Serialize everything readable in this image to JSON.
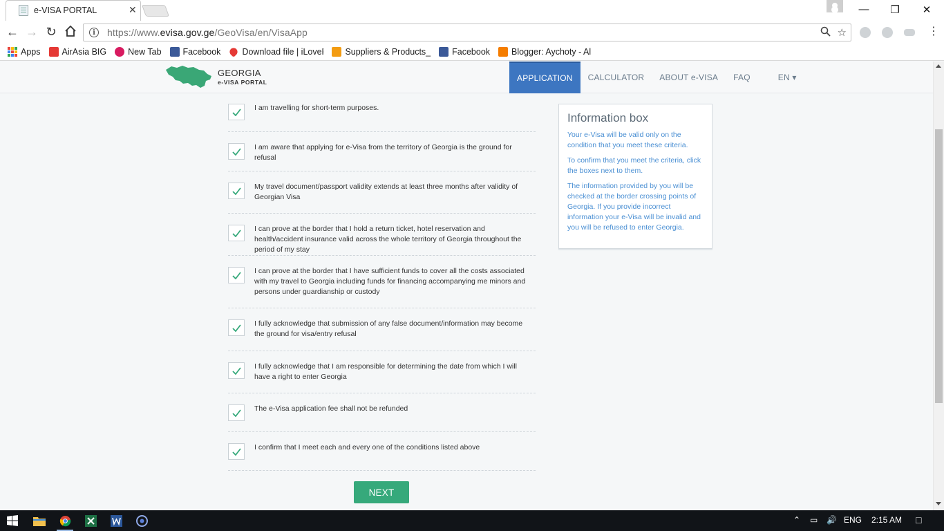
{
  "browser": {
    "tab_title": "e-VISA PORTAL",
    "tab_close": "✕",
    "url_prefix": "https://www.",
    "url_host": "evisa.gov.ge",
    "url_path": "/GeoVisa/en/VisaApp",
    "bookmarks": [
      {
        "label": "Apps",
        "icon": "apps-grid-icon",
        "color": "#e8453c"
      },
      {
        "label": "AirAsia BIG",
        "icon": "airasia-icon",
        "color": "#e53935"
      },
      {
        "label": "New Tab",
        "icon": "newtab-icon",
        "color": "#d81b60"
      },
      {
        "label": "Facebook",
        "icon": "facebook-icon",
        "color": "#3b5998"
      },
      {
        "label": "Download file | iLoveP",
        "icon": "heart-icon",
        "color": "#e53935"
      },
      {
        "label": "Suppliers & Products_",
        "icon": "suppliers-icon",
        "color": "#f39c12"
      },
      {
        "label": "Facebook",
        "icon": "facebook-icon",
        "color": "#3b5998"
      },
      {
        "label": "Blogger: Aychoty - All",
        "icon": "blogger-icon",
        "color": "#f57d00"
      }
    ]
  },
  "site": {
    "logo_title": "GEORGIA",
    "logo_subtitle": "e-VISA PORTAL",
    "brand_green": "#3aa776",
    "nav": [
      {
        "label": "APPLICATION",
        "active": true
      },
      {
        "label": "CALCULATOR",
        "active": false
      },
      {
        "label": "ABOUT e-VISA",
        "active": false
      },
      {
        "label": "FAQ",
        "active": false
      },
      {
        "label": "EN ▾",
        "active": false
      }
    ]
  },
  "criteria": [
    "I am travelling for short-term purposes.",
    "I am aware that applying for e-Visa from the territory of Georgia is the ground for refusal",
    "My travel document/passport validity extends at least three months after validity of Georgian Visa",
    "I can prove at the border that I hold a return ticket, hotel reservation and health/accident insurance valid across the whole territory of Georgia throughout the period of my stay",
    "I can prove at the border that I have sufficient funds to cover all the costs associated with my travel to Georgia including funds for financing accompanying me minors and persons under guardianship or custody",
    "I fully acknowledge that submission of any false document/information may become the ground for visa/entry refusal",
    "I fully acknowledge that I am responsible for determining the date from which I will have a right to enter Georgia",
    "The e-Visa application fee shall not be refunded",
    "I confirm that I meet each and every one of the conditions listed above"
  ],
  "next_label": "NEXT",
  "info_box": {
    "title": "Information box",
    "paragraphs": [
      "Your e-Visa will be valid only on the condition that you meet these criteria.",
      "To confirm that you meet the criteria, click the boxes next to them.",
      "The information provided by you will be checked at the border crossing points of Georgia. If you provide incorrect information your e-Visa will be invalid and you will be refused to enter Georgia."
    ]
  },
  "taskbar": {
    "language": "ENG",
    "time": "2:15 AM"
  }
}
